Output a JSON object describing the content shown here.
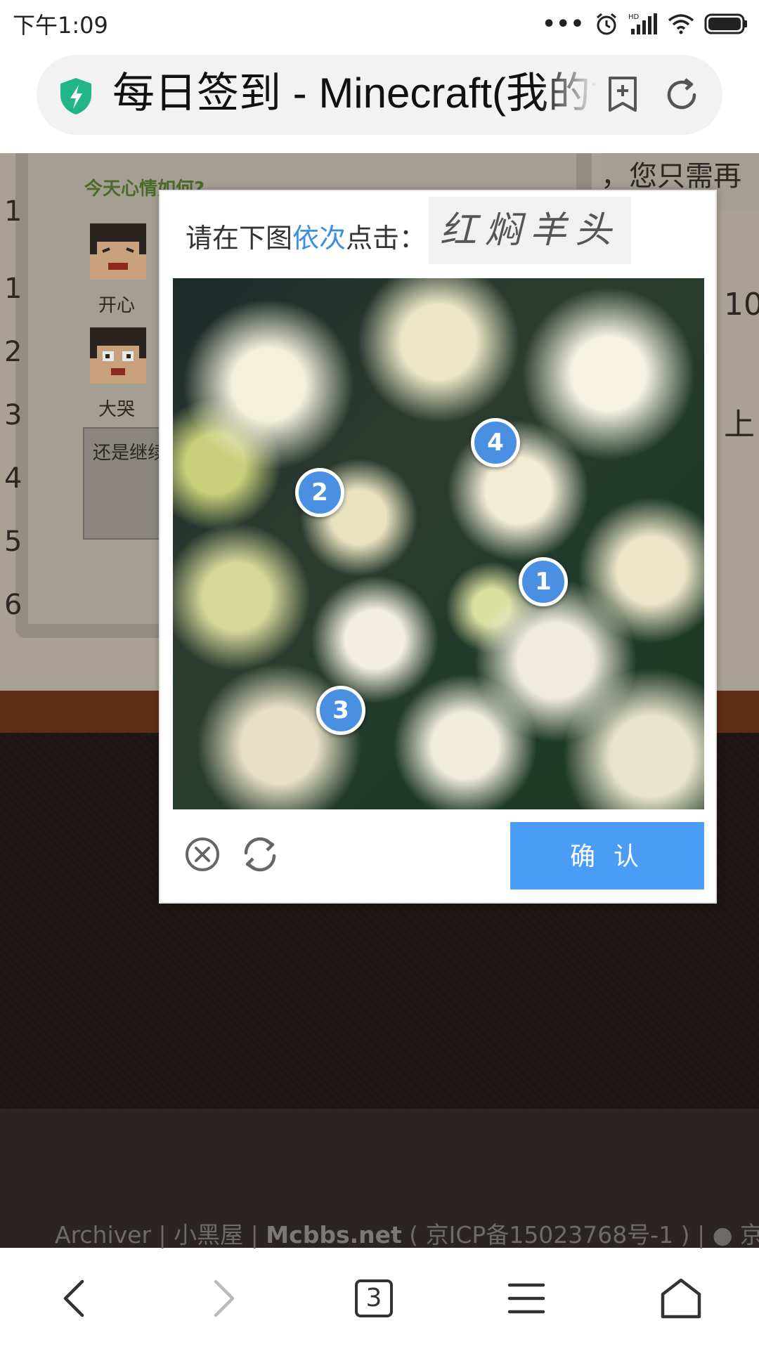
{
  "status": {
    "time": "下午1:09"
  },
  "browser": {
    "page_title": "每日签到 - Minecraft(我的世界)中文论坛",
    "tab_count": "3"
  },
  "background": {
    "mood_title": "今天心情如何?",
    "moods": [
      "开心",
      "大哭"
    ],
    "mood_textarea": "还是继续慌",
    "row_numbers": [
      "1",
      "2",
      "3",
      "4",
      "5",
      "6"
    ],
    "right_top_text": "，您只需再",
    "right_frags": [
      "10",
      "上"
    ],
    "footer": {
      "archiver": "Archiver",
      "sep": "|",
      "blackroom": "小黑屋",
      "site": "Mcbbs.net",
      "icp": "( 京ICP备15023768号-1 )",
      "police": "京公"
    }
  },
  "captcha": {
    "prompt_before": "请在下图",
    "prompt_highlight": "依次",
    "prompt_after": "点击：",
    "target_chars": "红焖羊头",
    "markers": [
      "1",
      "2",
      "3",
      "4"
    ],
    "confirm_label": "确 认",
    "accent": "#4a9cf6"
  }
}
